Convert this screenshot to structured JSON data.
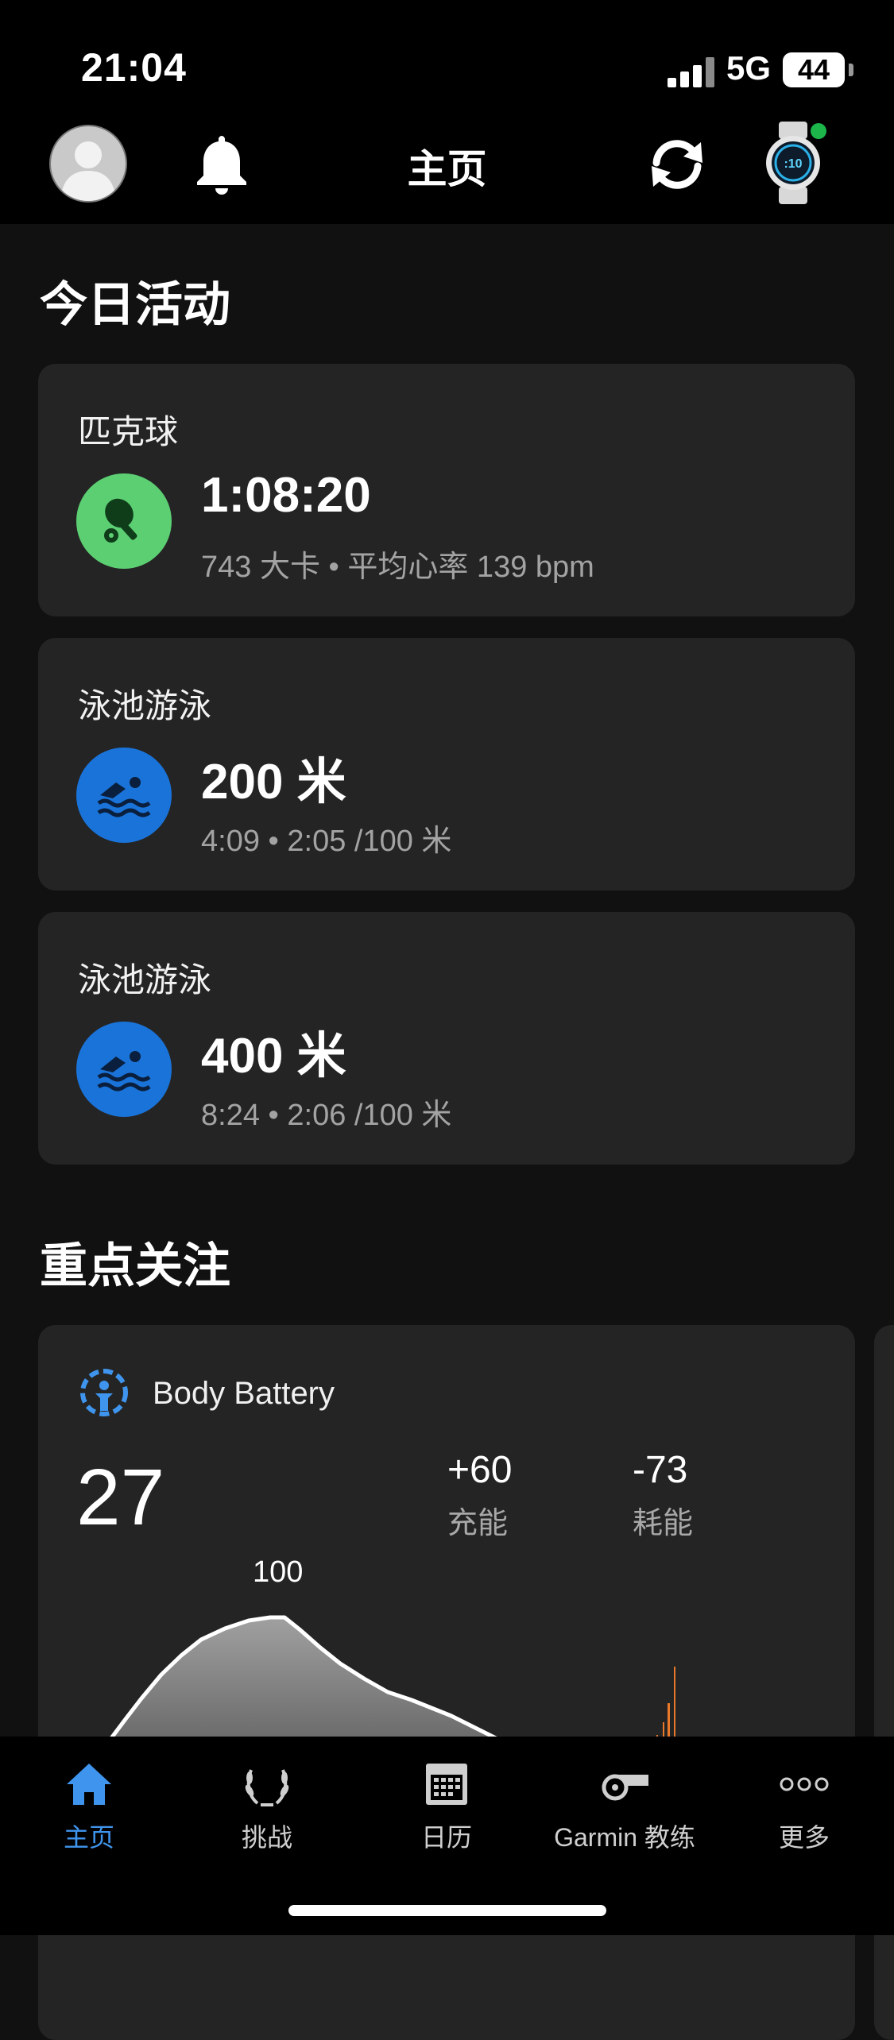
{
  "status_bar": {
    "time": "21:04",
    "network": "5G",
    "battery": "44"
  },
  "header": {
    "title": "主页"
  },
  "today": {
    "title": "今日活动",
    "activities": [
      {
        "name": "匹克球",
        "main": "1:08:20",
        "sub": "743  大卡 • 平均心率 139 bpm",
        "icon": "pickleball-icon",
        "color": "#5ccf73"
      },
      {
        "name": "泳池游泳",
        "main": "200 米",
        "sub": "4:09 • 2:05 /100 米",
        "icon": "swim-icon",
        "color": "#1a73d9"
      },
      {
        "name": "泳池游泳",
        "main": "400 米",
        "sub": "8:24 • 2:06 /100 米",
        "icon": "swim-icon",
        "color": "#1a73d9"
      }
    ]
  },
  "highlights": {
    "title": "重点关注",
    "body_battery": {
      "title": "Body Battery",
      "value": "27",
      "charged": {
        "value": "+60",
        "label": "充能"
      },
      "drained": {
        "value": "-73",
        "label": "耗能"
      },
      "peak_label": "100"
    }
  },
  "tabs": [
    {
      "label": "主页",
      "icon": "home-icon",
      "active": true
    },
    {
      "label": "挑战",
      "icon": "laurel-icon",
      "active": false
    },
    {
      "label": "日历",
      "icon": "calendar-icon",
      "active": false
    },
    {
      "label": "Garmin 教练",
      "icon": "whistle-icon",
      "active": false
    },
    {
      "label": "更多",
      "icon": "more-icon",
      "active": false
    }
  ],
  "colors": {
    "accent": "#3f95ee",
    "card": "#242424",
    "background": "#111111",
    "pickleball": "#5ccf73",
    "swim": "#1a73d9",
    "battery_chart_line": "#ffffff",
    "stress_bars": "#e8792b"
  }
}
